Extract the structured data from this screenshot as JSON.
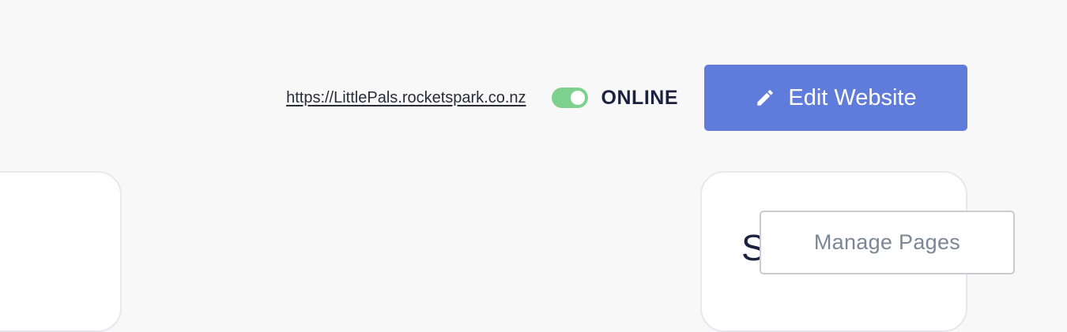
{
  "header": {
    "site_url": "https://LittlePals.rocketspark.co.nz",
    "status": {
      "label": "ONLINE",
      "enabled": true,
      "toggle_color": "#7ed08f"
    },
    "edit_button": {
      "label": "Edit Website",
      "icon": "pencil-icon",
      "color": "#5f7cdb"
    }
  },
  "seo_card": {
    "title": "SEO",
    "manage_button_label": "Manage Pages"
  }
}
